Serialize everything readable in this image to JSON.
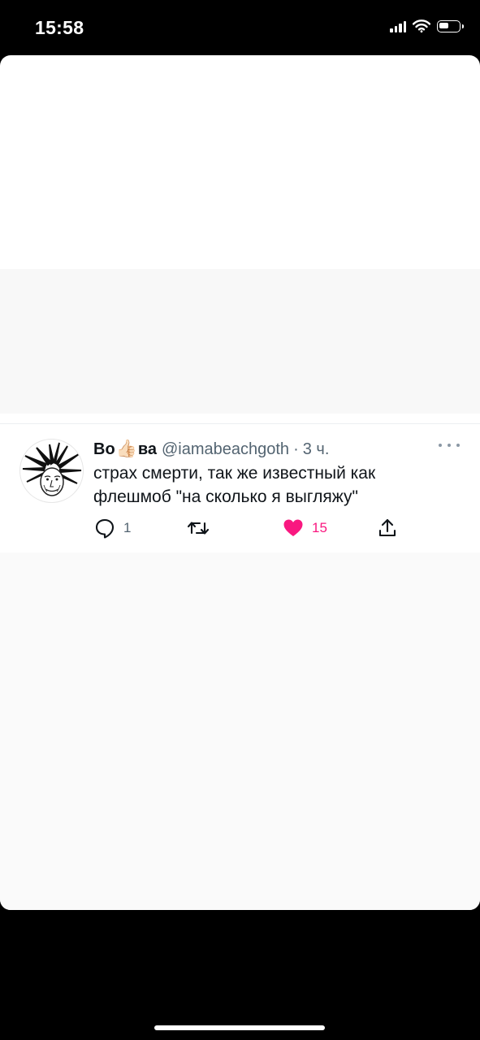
{
  "status_bar": {
    "time": "15:58",
    "icons": [
      "signal-icon",
      "wifi-icon",
      "battery-icon"
    ],
    "battery_level": 0.4
  },
  "tweet": {
    "display_name_start": "Во",
    "display_name_emoji": "👍🏻",
    "display_name_end": "ва",
    "handle": "@iamabeachgoth",
    "separator": "·",
    "time": "3 ч.",
    "text": "страх смерти, так же известный как флешмоб \"на сколько я выгляжу\"",
    "actions": {
      "reply": {
        "icon": "reply-icon",
        "count": "1"
      },
      "retweet": {
        "icon": "retweet-icon",
        "count": ""
      },
      "like": {
        "icon": "heart-icon",
        "count": "15",
        "active": true,
        "color": "#f91880"
      },
      "share": {
        "icon": "share-icon"
      }
    },
    "more_icon": "more-dots-icon",
    "avatar": "avatar-drawing"
  },
  "colors": {
    "text_primary": "#0f1419",
    "text_secondary": "#536471",
    "like_pink": "#f91880",
    "background": "#000000"
  }
}
